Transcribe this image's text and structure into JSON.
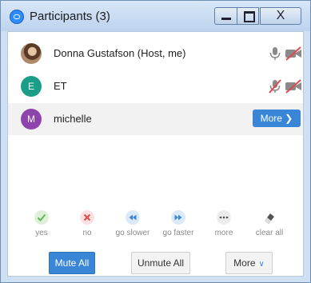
{
  "window": {
    "title": "Participants (3)",
    "close_glyph": "X"
  },
  "participants": [
    {
      "name": "Donna Gustafson (Host, me)",
      "avatar_type": "photo",
      "initial": "",
      "mic": "on",
      "video": "off"
    },
    {
      "name": "ET",
      "avatar_type": "initial",
      "initial": "E",
      "avatar_color": "#1a9e88",
      "mic": "muted",
      "video": "off"
    },
    {
      "name": "michelle",
      "avatar_type": "initial",
      "initial": "M",
      "avatar_color": "#8e44ad",
      "more_label": "More ❯",
      "highlighted": true
    }
  ],
  "feedback": [
    {
      "label": "yes",
      "icon": "check-icon",
      "color": "#5cb85c"
    },
    {
      "label": "no",
      "icon": "x-icon",
      "color": "#e04a4a"
    },
    {
      "label": "go slower",
      "icon": "rewind-icon",
      "color": "#3a86d6"
    },
    {
      "label": "go faster",
      "icon": "fast-forward-icon",
      "color": "#3a86d6"
    },
    {
      "label": "more",
      "icon": "ellipsis-icon",
      "color": "#555555"
    },
    {
      "label": "clear all",
      "icon": "eraser-icon",
      "color": "#555555"
    }
  ],
  "actions": {
    "mute_all": "Mute All",
    "unmute_all": "Unmute All",
    "more": "More"
  },
  "colors": {
    "accent": "#3a86d6",
    "title_bar": "#bcd3ee",
    "mute_red": "#e04a4a"
  }
}
